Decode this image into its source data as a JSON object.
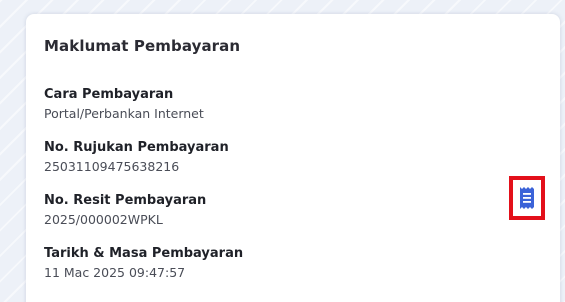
{
  "card": {
    "title": "Maklumat Pembayaran",
    "fields": [
      {
        "label": "Cara Pembayaran",
        "value": "Portal/Perbankan Internet"
      },
      {
        "label": "No. Rujukan Pembayaran",
        "value": "25031109475638216"
      },
      {
        "label": "No. Resit Pembayaran",
        "value": "2025/000002WPKL"
      },
      {
        "label": "Tarikh & Masa Pembayaran",
        "value": "11 Mac 2025 09:47:57"
      }
    ]
  },
  "receipt_button": {
    "icon": "receipt-icon",
    "icon_color": "#3b63d8",
    "highlight_color": "#e3101a"
  }
}
